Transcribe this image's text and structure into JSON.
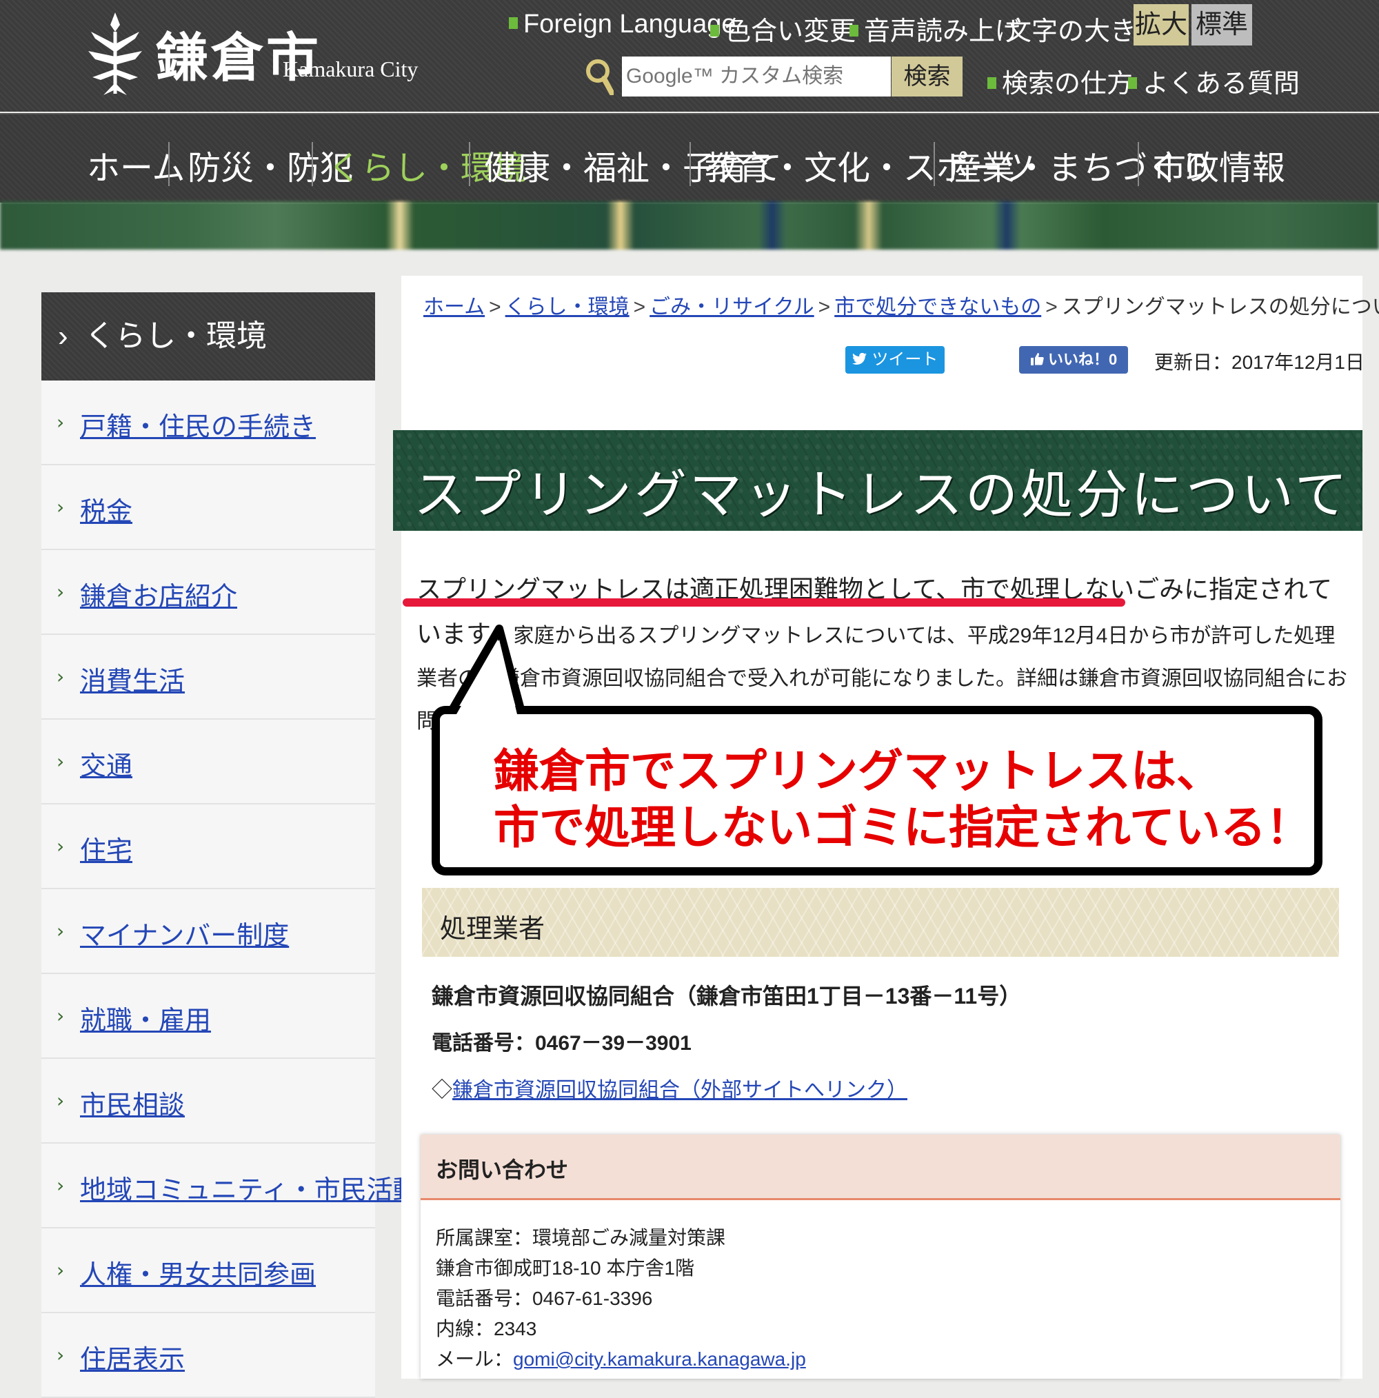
{
  "header": {
    "logo_name": "鎌倉市",
    "logo_sub": "Kamakura City",
    "foreign_language": "Foreign Language",
    "color_change": "色合い変更",
    "voice_read": "音声読み上げ",
    "font_size_label": "文字の大きさ",
    "font_enlarge": "拡大",
    "font_standard": "標準",
    "search_placeholder": "Google™ カスタム検索",
    "search_button": "検索",
    "search_howto": "検索の仕方",
    "faq": "よくある質問"
  },
  "gnav": {
    "items": [
      "ホーム",
      "防災・防犯",
      "くらし・環境",
      "健康・福祉・子育て",
      "教育・文化・スポーツ",
      "産業・まちづくり",
      "市政情報"
    ],
    "active_index": 2,
    "active_color": "#9ed15b"
  },
  "sidebar": {
    "heading": "くらし・環境",
    "items": [
      "戸籍・住民の手続き",
      "税金",
      "鎌倉お店紹介",
      "消費生活",
      "交通",
      "住宅",
      "マイナンバー制度",
      "就職・雇用",
      "市民相談",
      "地域コミュニティ・市民活動",
      "人権・男女共同参画",
      "住居表示"
    ]
  },
  "breadcrumb": {
    "items": [
      "ホーム",
      "くらし・環境",
      "ごみ・リサイクル",
      "市で処分できないもの"
    ],
    "current": "スプリングマットレスの処分について",
    "separator": ">"
  },
  "social": {
    "tweet": "ツイート",
    "like": "いいね！0"
  },
  "updated": "更新日：2017年12月1日",
  "page_title": "スプリングマットレスの処分について",
  "lead": {
    "emphasis": "スプリングマットレスは適正処理困難物として、市で処理しないごみに指定されています。",
    "rest": "家庭から出るスプリングマットレスについては、平成29年12月4日から市が許可した処理業者の、鎌倉市資源回収協同組合で受入れが可能になりました。詳細は鎌倉市資源回収協同組合にお問い合わせください。"
  },
  "callout": {
    "line1": "鎌倉市でスプリングマットレスは、",
    "line2": "市で処理しないゴミに指定されている！",
    "color": "#e60000"
  },
  "section": {
    "heading": "処理業者",
    "company": "鎌倉市資源回収協同組合（鎌倉市笛田1丁目－13番－11号）",
    "tel": "電話番号：0467－39－3901",
    "link_prefix": "◇",
    "link": "鎌倉市資源回収協同組合（外部サイトへリンク）"
  },
  "contact": {
    "heading": "お問い合わせ",
    "dept": "所属課室：環境部ごみ減量対策課",
    "address": "鎌倉市御成町18-10 本庁舎1階",
    "tel": "電話番号：0467-61-3396",
    "ext": "内線：2343",
    "mail_label": "メール：",
    "mail": "gomi@city.kamakura.kanagawa.jp"
  }
}
